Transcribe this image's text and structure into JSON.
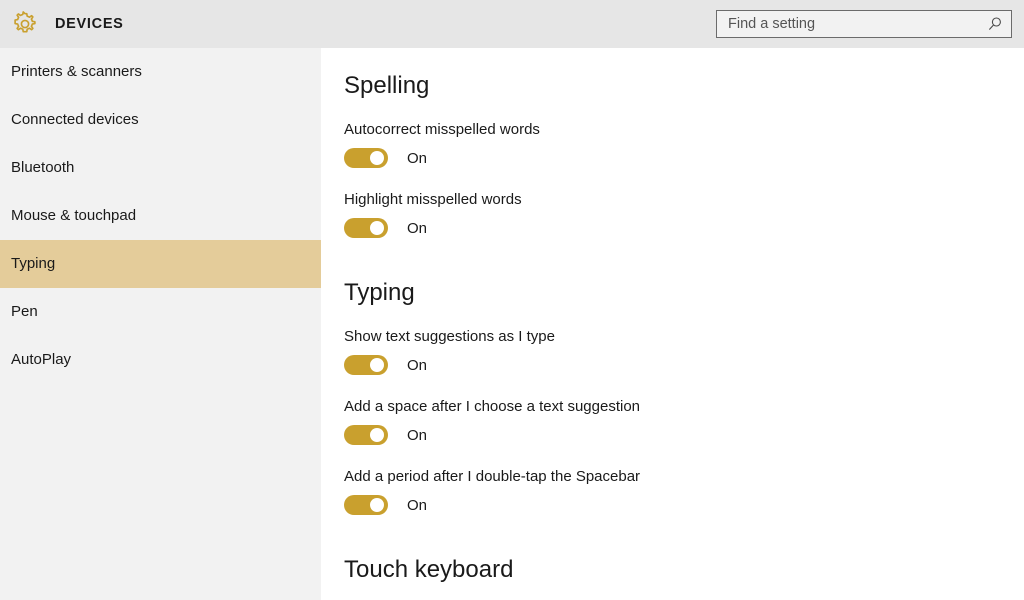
{
  "header": {
    "icon": "gear-icon",
    "title": "DEVICES",
    "search": {
      "placeholder": "Find a setting",
      "value": "",
      "icon": "search-icon"
    }
  },
  "sidebar": {
    "items": [
      {
        "label": "Printers & scanners",
        "selected": false
      },
      {
        "label": "Connected devices",
        "selected": false
      },
      {
        "label": "Bluetooth",
        "selected": false
      },
      {
        "label": "Mouse & touchpad",
        "selected": false
      },
      {
        "label": "Typing",
        "selected": true
      },
      {
        "label": "Pen",
        "selected": false
      },
      {
        "label": "AutoPlay",
        "selected": false
      }
    ]
  },
  "main": {
    "sections": [
      {
        "heading": "Spelling",
        "settings": [
          {
            "label": "Autocorrect misspelled words",
            "state": "On",
            "checked": true
          },
          {
            "label": "Highlight misspelled words",
            "state": "On",
            "checked": true
          }
        ]
      },
      {
        "heading": "Typing",
        "settings": [
          {
            "label": "Show text suggestions as I type",
            "state": "On",
            "checked": true
          },
          {
            "label": "Add a space after I choose a text suggestion",
            "state": "On",
            "checked": true
          },
          {
            "label": "Add a period after I double-tap the Spacebar",
            "state": "On",
            "checked": true
          }
        ]
      },
      {
        "heading": "Touch keyboard",
        "settings": []
      }
    ]
  },
  "colors": {
    "accent": "#c9a02e",
    "selection": "#e4cc9a",
    "header_bg": "#e6e6e6",
    "sidebar_bg": "#f2f2f2",
    "content_bg": "#ffffff",
    "text": "#1a1a1a"
  }
}
